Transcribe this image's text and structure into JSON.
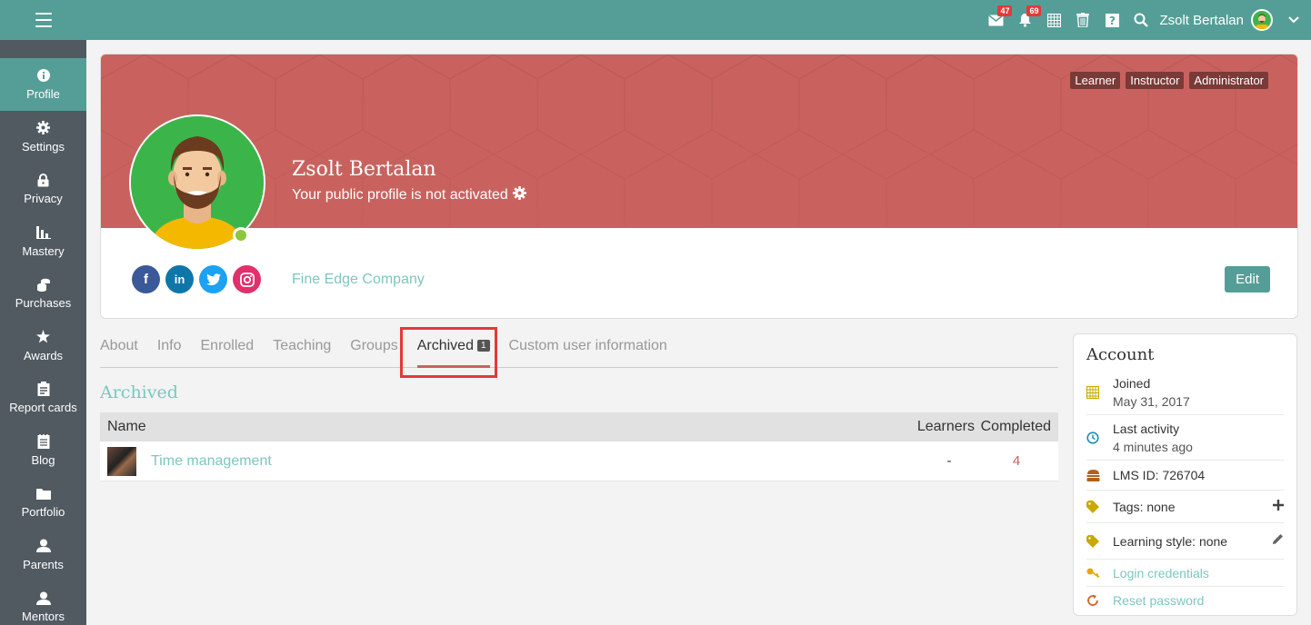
{
  "topbar": {
    "messages_count": "47",
    "notifications_count": "69",
    "user_name": "Zsolt Bertalan"
  },
  "sidebar": {
    "items": [
      {
        "label": "Profile",
        "icon": "info-icon"
      },
      {
        "label": "Settings",
        "icon": "gear-icon"
      },
      {
        "label": "Privacy",
        "icon": "lock-icon"
      },
      {
        "label": "Mastery",
        "icon": "bar-chart-icon"
      },
      {
        "label": "Purchases",
        "icon": "coins-icon"
      },
      {
        "label": "Awards",
        "icon": "star-icon"
      },
      {
        "label": "Report cards",
        "icon": "report-card-icon"
      },
      {
        "label": "Blog",
        "icon": "blog-icon"
      },
      {
        "label": "Portfolio",
        "icon": "folder-icon"
      },
      {
        "label": "Parents",
        "icon": "user-icon"
      },
      {
        "label": "Mentors",
        "icon": "user-icon"
      }
    ]
  },
  "profile": {
    "name": "Zsolt Bertalan",
    "status": "Your public profile is not activated",
    "roles": [
      "Learner",
      "Instructor",
      "Administrator"
    ],
    "company": "Fine Edge Company",
    "edit_label": "Edit",
    "socials": [
      "facebook-icon",
      "linkedin-icon",
      "twitter-icon",
      "instagram-icon"
    ],
    "colors": {
      "banner": "#c9625e",
      "accent": "#559e97",
      "link": "#7cc7bf"
    }
  },
  "tabs": [
    {
      "label": "About"
    },
    {
      "label": "Info"
    },
    {
      "label": "Enrolled"
    },
    {
      "label": "Teaching"
    },
    {
      "label": "Groups"
    },
    {
      "label": "Archived",
      "count": "1"
    },
    {
      "label": "Custom user information"
    }
  ],
  "archived": {
    "title": "Archived",
    "columns": {
      "name": "Name",
      "learners": "Learners",
      "completed": "Completed"
    },
    "rows": [
      {
        "name": "Time management",
        "learners": "-",
        "completed": "4"
      }
    ]
  },
  "account": {
    "title": "Account",
    "joined_label": "Joined",
    "joined_value": "May 31, 2017",
    "last_activity_label": "Last activity",
    "last_activity_value": "4 minutes ago",
    "lms_id": "LMS ID: 726704",
    "tags": "Tags: none",
    "learning_style": "Learning style: none",
    "login_credentials": "Login credentials",
    "reset_password": "Reset password"
  }
}
